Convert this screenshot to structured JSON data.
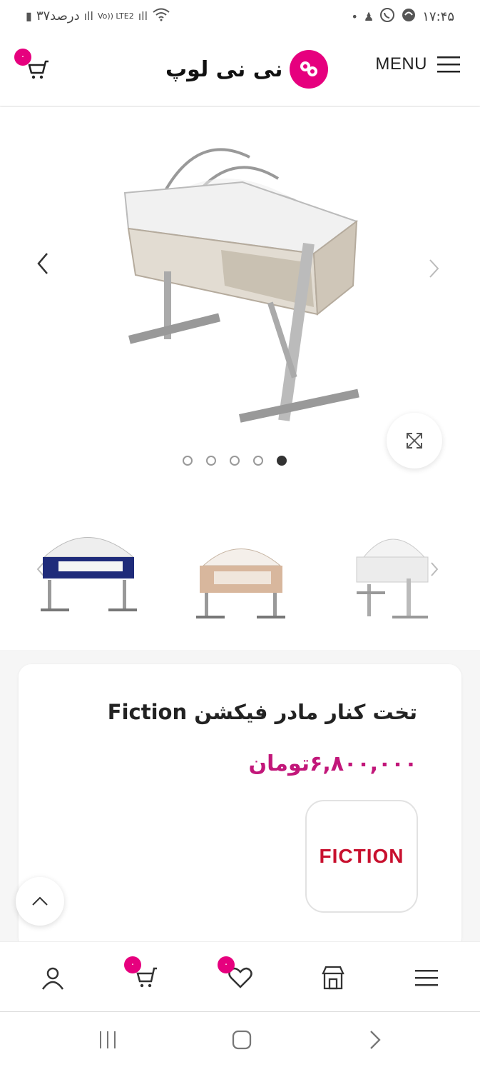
{
  "status_bar": {
    "time": "۱۷:۴۵",
    "battery": "۳۷درصد",
    "network": "Vo)) LTE2"
  },
  "header": {
    "logo_text": "نی نی لوپ",
    "menu_label": "MENU",
    "cart_count": "۰"
  },
  "gallery": {
    "main_image_alt": "Fiction bedside crib",
    "dots_total": 5,
    "active_dot": 5
  },
  "thumbnails": [
    {
      "name": "navy crib"
    },
    {
      "name": "beige crib"
    },
    {
      "name": "grey crib"
    }
  ],
  "product": {
    "title": "تخت کنار مادر فیکشن Fiction",
    "price": "۶,۸۰۰,۰۰۰تومان",
    "brand": "FICTION"
  },
  "bottom_nav": {
    "cart_count": "۰",
    "wishlist_count": "۰"
  },
  "colors": {
    "accent": "#e6007e",
    "price": "#c2177a",
    "brand": "#c8102e"
  }
}
